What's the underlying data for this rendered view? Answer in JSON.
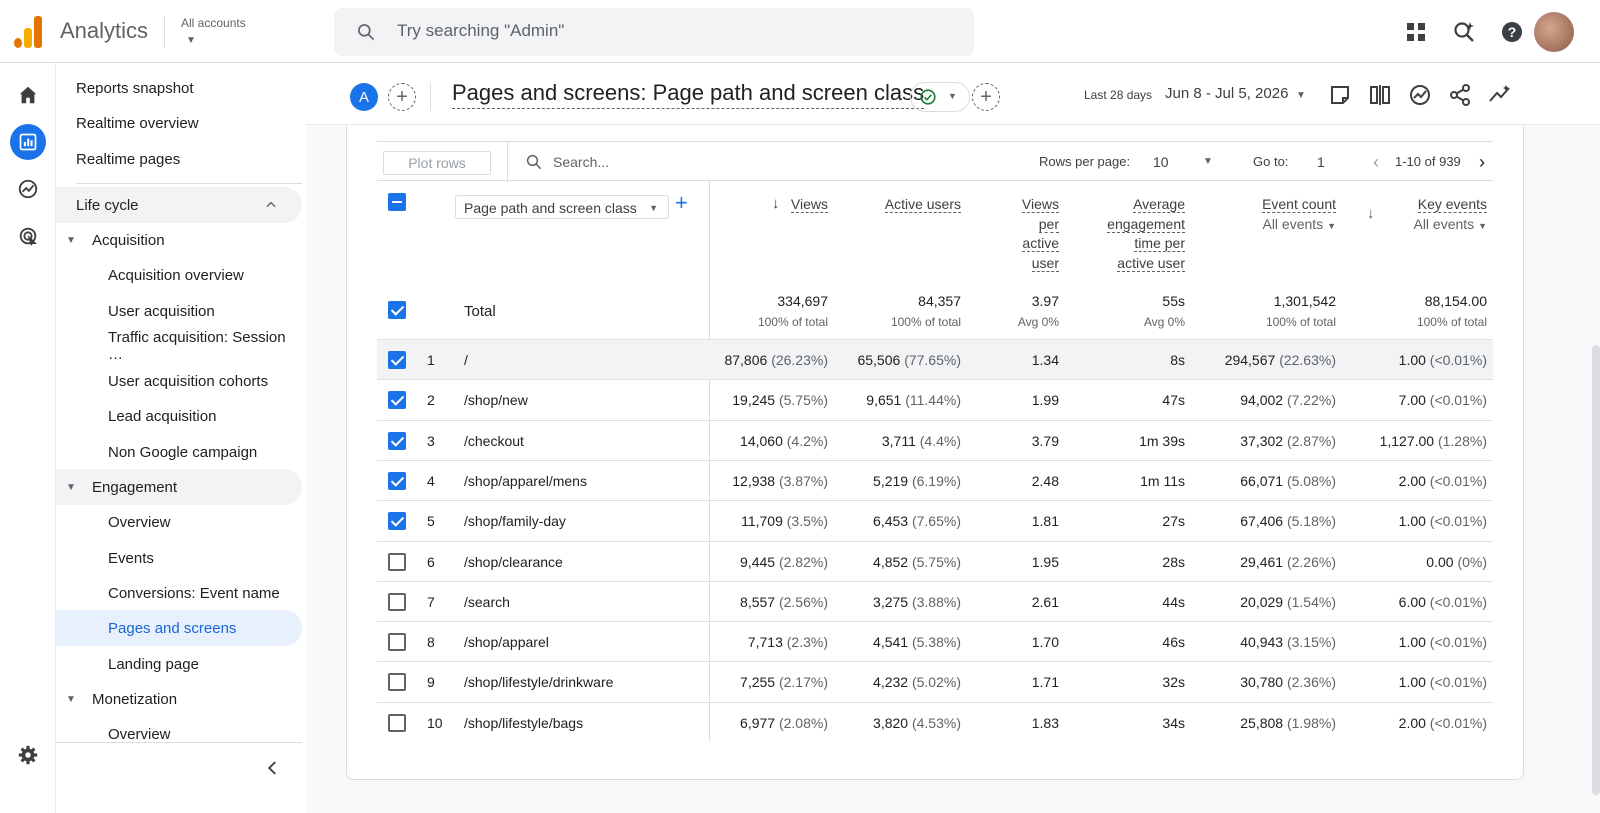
{
  "app": {
    "title": "Analytics",
    "accounts_label": "All accounts"
  },
  "search": {
    "placeholder": "Try searching \"Admin\""
  },
  "nav": {
    "items": [
      {
        "label": "Reports snapshot"
      },
      {
        "label": "Realtime overview"
      },
      {
        "label": "Realtime pages"
      },
      {
        "label": "Life cycle"
      },
      {
        "label": "Acquisition"
      },
      {
        "label": "Acquisition overview"
      },
      {
        "label": "User acquisition"
      },
      {
        "label": "Traffic acquisition: Session …"
      },
      {
        "label": "User acquisition cohorts"
      },
      {
        "label": "Lead acquisition"
      },
      {
        "label": "Non Google campaign"
      },
      {
        "label": "Engagement"
      },
      {
        "label": "Overview"
      },
      {
        "label": "Events"
      },
      {
        "label": "Conversions: Event name"
      },
      {
        "label": "Pages and screens"
      },
      {
        "label": "Landing page"
      },
      {
        "label": "Monetization"
      },
      {
        "label": "Overview"
      }
    ]
  },
  "header": {
    "avatar_letter": "A",
    "title": "Pages and screens: Page path and screen class",
    "date_label": "Last 28 days",
    "date_range": "Jun 8 - Jul 5, 2026"
  },
  "toolbar": {
    "plot_rows": "Plot rows",
    "search_placeholder": "Search...",
    "rows_per_page_label": "Rows per page:",
    "rows_per_page": "10",
    "goto_label": "Go to:",
    "goto_value": "1",
    "page_range": "1-10 of 939"
  },
  "table": {
    "dimension": "Page path and screen class",
    "columns": {
      "views": "Views",
      "active_users": "Active users",
      "vpau": [
        "Views",
        "per",
        "active",
        "user"
      ],
      "aet": [
        "Average",
        "engagement",
        "time per",
        "active user"
      ],
      "event_count": "Event count",
      "event_count_sub": "All events",
      "key_events": "Key events",
      "key_events_sub": "All events"
    },
    "total": {
      "label": "Total",
      "views": "334,697",
      "views_sub": "100% of total",
      "active_users": "84,357",
      "active_users_sub": "100% of total",
      "vpau": "3.97",
      "vpau_sub": "Avg 0%",
      "aet": "55s",
      "aet_sub": "Avg 0%",
      "event_count": "1,301,542",
      "event_count_sub": "100% of total",
      "key_events": "88,154.00",
      "key_events_sub": "100% of total"
    },
    "rows": [
      {
        "n": "1",
        "path": "/",
        "views": "87,806",
        "views_p": "(26.23%)",
        "users": "65,506",
        "users_p": "(77.65%)",
        "vpau": "1.34",
        "aet": "8s",
        "ec": "294,567",
        "ec_p": "(22.63%)",
        "ke": "1.00",
        "ke_p": "(<0.01%)",
        "checked": true
      },
      {
        "n": "2",
        "path": "/shop/new",
        "views": "19,245",
        "views_p": "(5.75%)",
        "users": "9,651",
        "users_p": "(11.44%)",
        "vpau": "1.99",
        "aet": "47s",
        "ec": "94,002",
        "ec_p": "(7.22%)",
        "ke": "7.00",
        "ke_p": "(<0.01%)",
        "checked": true
      },
      {
        "n": "3",
        "path": "/checkout",
        "views": "14,060",
        "views_p": "(4.2%)",
        "users": "3,711",
        "users_p": "(4.4%)",
        "vpau": "3.79",
        "aet": "1m 39s",
        "ec": "37,302",
        "ec_p": "(2.87%)",
        "ke": "1,127.00",
        "ke_p": "(1.28%)",
        "checked": true
      },
      {
        "n": "4",
        "path": "/shop/apparel/mens",
        "views": "12,938",
        "views_p": "(3.87%)",
        "users": "5,219",
        "users_p": "(6.19%)",
        "vpau": "2.48",
        "aet": "1m 11s",
        "ec": "66,071",
        "ec_p": "(5.08%)",
        "ke": "2.00",
        "ke_p": "(<0.01%)",
        "checked": true
      },
      {
        "n": "5",
        "path": "/shop/family-day",
        "views": "11,709",
        "views_p": "(3.5%)",
        "users": "6,453",
        "users_p": "(7.65%)",
        "vpau": "1.81",
        "aet": "27s",
        "ec": "67,406",
        "ec_p": "(5.18%)",
        "ke": "1.00",
        "ke_p": "(<0.01%)",
        "checked": true
      },
      {
        "n": "6",
        "path": "/shop/clearance",
        "views": "9,445",
        "views_p": "(2.82%)",
        "users": "4,852",
        "users_p": "(5.75%)",
        "vpau": "1.95",
        "aet": "28s",
        "ec": "29,461",
        "ec_p": "(2.26%)",
        "ke": "0.00",
        "ke_p": "(0%)",
        "checked": false
      },
      {
        "n": "7",
        "path": "/search",
        "views": "8,557",
        "views_p": "(2.56%)",
        "users": "3,275",
        "users_p": "(3.88%)",
        "vpau": "2.61",
        "aet": "44s",
        "ec": "20,029",
        "ec_p": "(1.54%)",
        "ke": "6.00",
        "ke_p": "(<0.01%)",
        "checked": false
      },
      {
        "n": "8",
        "path": "/shop/apparel",
        "views": "7,713",
        "views_p": "(2.3%)",
        "users": "4,541",
        "users_p": "(5.38%)",
        "vpau": "1.70",
        "aet": "46s",
        "ec": "40,943",
        "ec_p": "(3.15%)",
        "ke": "1.00",
        "ke_p": "(<0.01%)",
        "checked": false
      },
      {
        "n": "9",
        "path": "/shop/lifestyle/drinkware",
        "views": "7,255",
        "views_p": "(2.17%)",
        "users": "4,232",
        "users_p": "(5.02%)",
        "vpau": "1.71",
        "aet": "32s",
        "ec": "30,780",
        "ec_p": "(2.36%)",
        "ke": "1.00",
        "ke_p": "(<0.01%)",
        "checked": false
      },
      {
        "n": "10",
        "path": "/shop/lifestyle/bags",
        "views": "6,977",
        "views_p": "(2.08%)",
        "users": "3,820",
        "users_p": "(4.53%)",
        "vpau": "1.83",
        "aet": "34s",
        "ec": "25,808",
        "ec_p": "(1.98%)",
        "ke": "2.00",
        "ke_p": "(<0.01%)",
        "checked": false
      }
    ]
  },
  "colors": {
    "accent": "#1a73e8",
    "nav_selected_bg": "#e8f0fe",
    "logo_orange": "#f9ab00",
    "logo_dark": "#e37400"
  },
  "icons": [
    "search-icon",
    "apps-grid-icon",
    "search-insights-icon",
    "help-icon",
    "home-icon",
    "reports-icon",
    "explore-icon",
    "advertising-icon",
    "settings-icon",
    "collapse-icon",
    "compare-icon",
    "insights-icon",
    "share-icon",
    "trend-icon",
    "check-circle-icon"
  ]
}
